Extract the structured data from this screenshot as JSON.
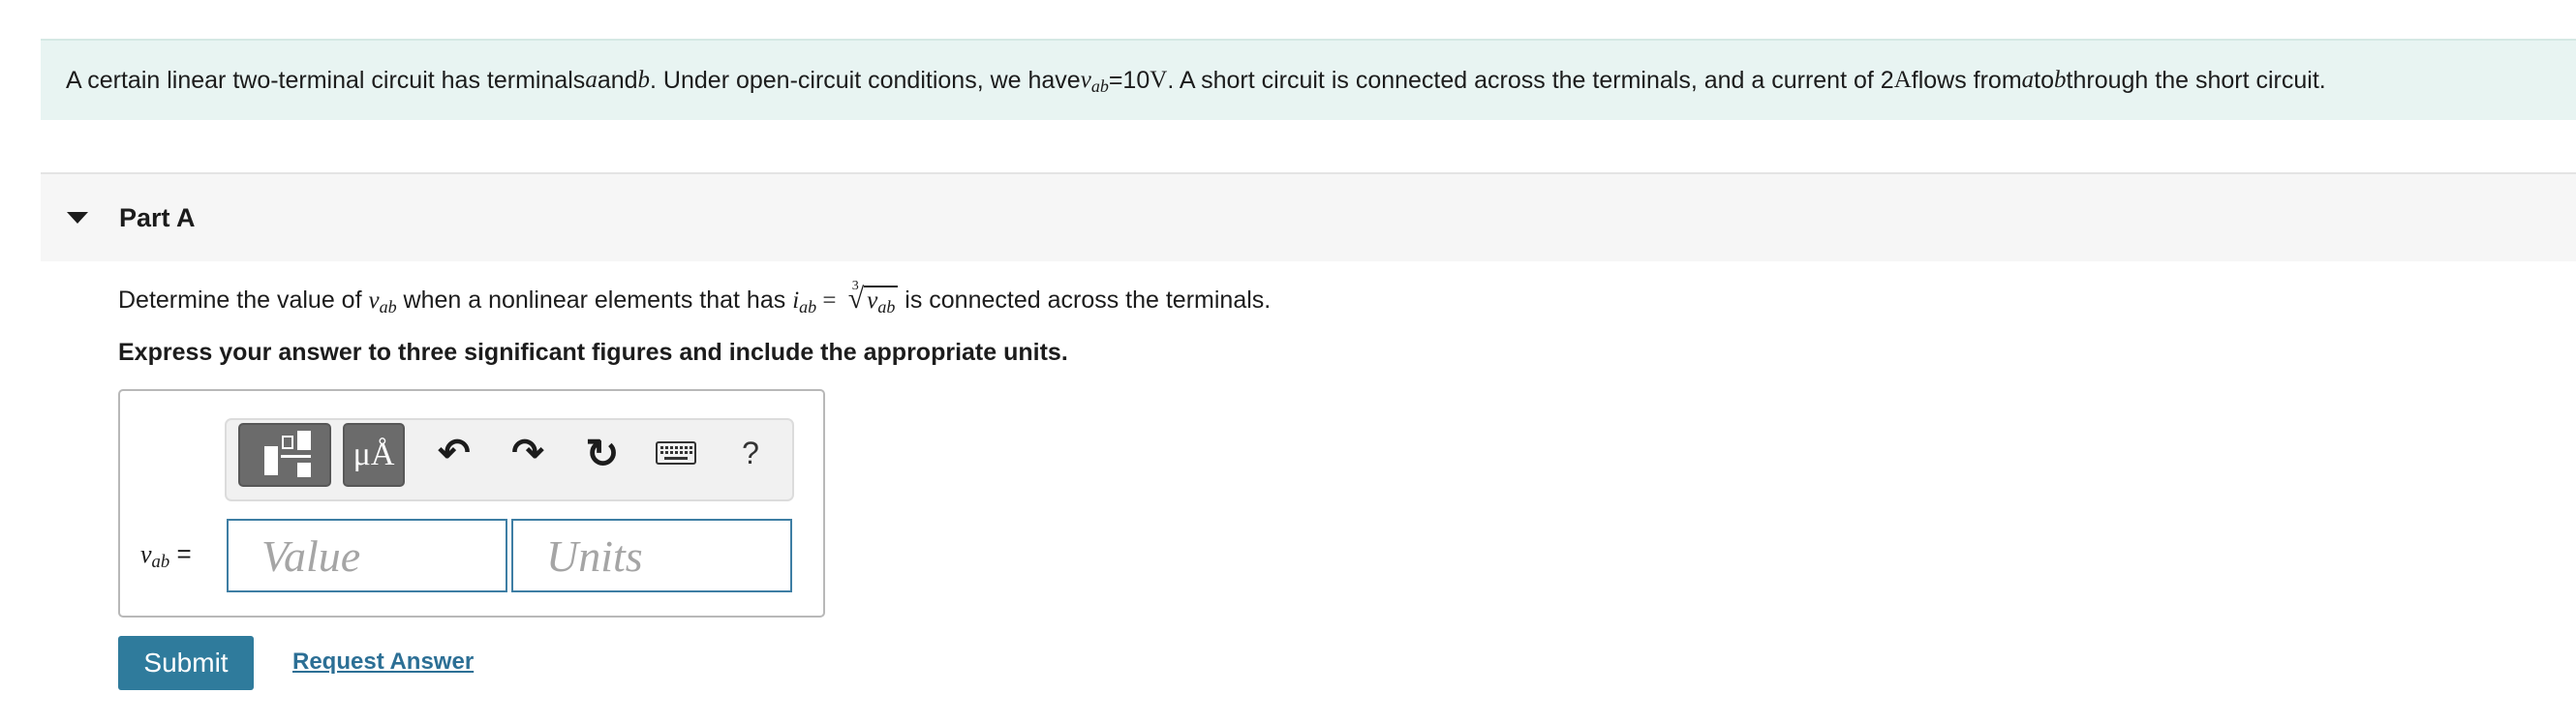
{
  "problem": {
    "s1": "A certain linear two-terminal circuit has terminals ",
    "a": "a",
    "s2": " and ",
    "b": "b",
    "s3": ". Under open-circuit conditions, we have ",
    "v": "v",
    "ab_sub": "ab",
    "s4": " =10 ",
    "volt_unit": "V",
    "s5": ". A short circuit is connected across the terminals, and a current of 2 ",
    "amp_unit": "A",
    "s6": " flows from ",
    "a2": "a",
    "s7": " to ",
    "b2": "b",
    "s8": " through the short circuit."
  },
  "part": {
    "title": "Part A"
  },
  "question": {
    "s1": "Determine the value of ",
    "v": "v",
    "ab": "ab",
    "s2": " when a nonlinear elements that has ",
    "i": "i",
    "ab2": "ab",
    "eq": " = ",
    "root_index": "3",
    "root_symbol": "√",
    "rad_v": "v",
    "rad_ab": "ab",
    "s3": " is connected across the terminals."
  },
  "instruction": "Express your answer to three significant figures and include the appropriate units.",
  "toolbar": {
    "units_label": "μÅ",
    "undo": "↶",
    "redo": "↷",
    "reset": "↻",
    "help": "?"
  },
  "answer": {
    "label_var": "v",
    "label_sub": "ab",
    "label_eq": " =",
    "value_placeholder": "Value",
    "units_placeholder": "Units"
  },
  "actions": {
    "submit_label": "Submit",
    "request_label": "Request Answer"
  },
  "colors": {
    "problem_bg": "#e8f4f2",
    "submit_bg": "#2f7b9c",
    "link": "#2c6f95",
    "input_border": "#3e7ea4",
    "toolbar_button": "#6b6b6b"
  }
}
